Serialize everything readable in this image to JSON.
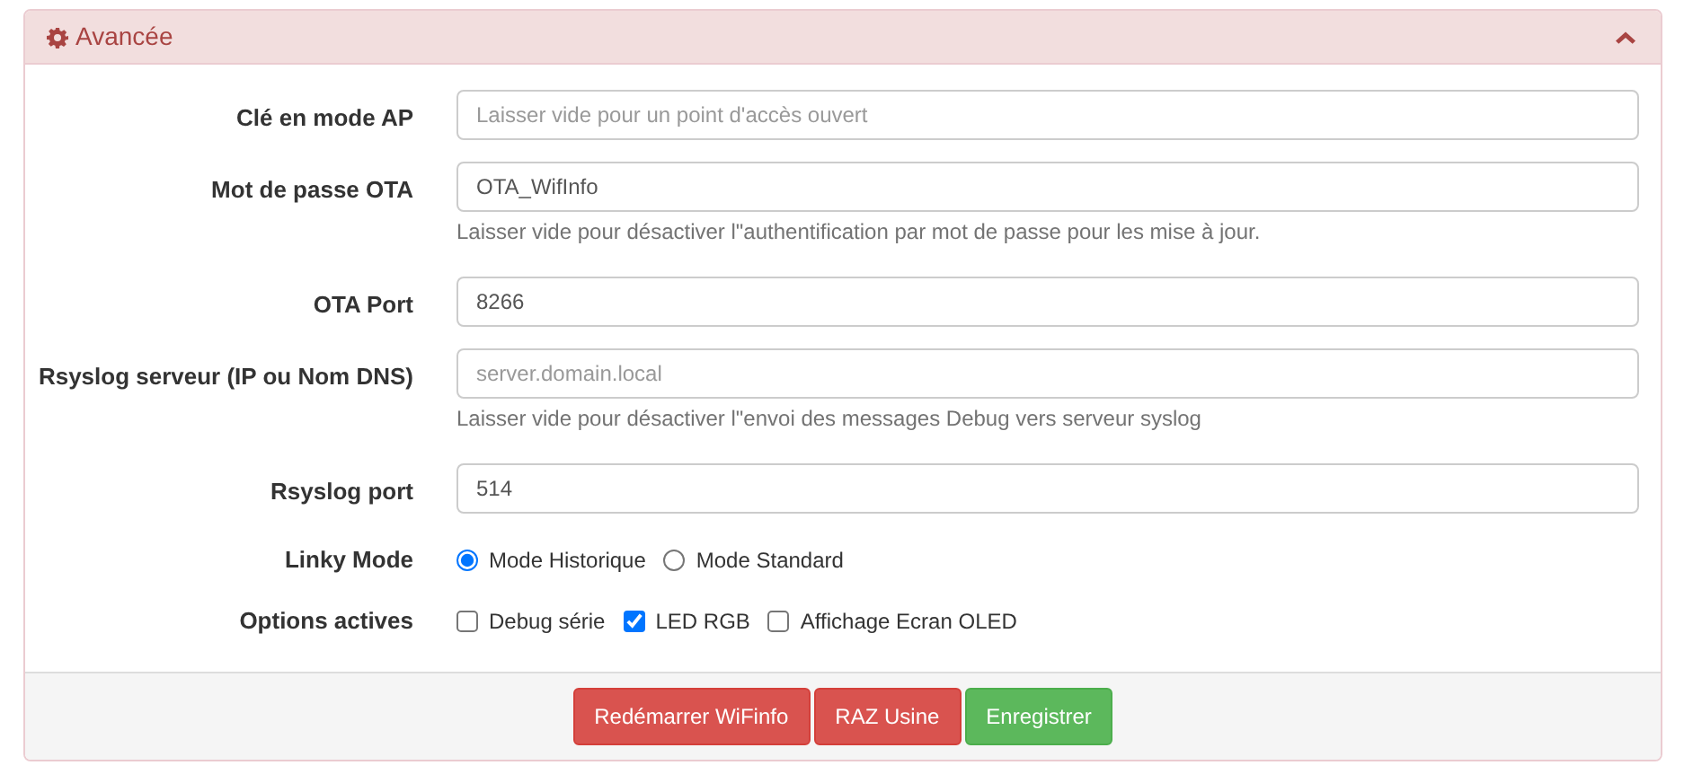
{
  "panel": {
    "title": "Avancée",
    "expanded": true
  },
  "fields": [
    {
      "kind": "text",
      "label": "Clé en mode AP",
      "placeholder": "Laisser vide pour un point d'accès ouvert"
    },
    {
      "kind": "text",
      "label": "Mot de passe OTA",
      "value": "OTA_WifInfo",
      "help": "Laisser vide pour désactiver l\"authentification par mot de passe pour les mise à jour."
    },
    {
      "kind": "text",
      "label": "OTA Port",
      "value": "8266"
    },
    {
      "kind": "text",
      "label": "Rsyslog serveur (IP ou Nom DNS)",
      "placeholder": "server.domain.local",
      "help": "Laisser vide pour désactiver l\"envoi des messages Debug vers serveur syslog"
    },
    {
      "kind": "text",
      "label": "Rsyslog port",
      "value": "514"
    },
    {
      "kind": "radio",
      "label": "Linky Mode",
      "options": [
        {
          "label": "Mode Historique",
          "selected": true
        },
        {
          "label": "Mode Standard",
          "selected": false
        }
      ]
    },
    {
      "kind": "checkbox",
      "label": "Options actives",
      "options": [
        {
          "label": "Debug série",
          "checked": false
        },
        {
          "label": "LED RGB",
          "checked": true
        },
        {
          "label": "Affichage Ecran OLED",
          "checked": false
        }
      ]
    }
  ],
  "buttons": [
    {
      "label": "Redémarrer WiFinfo",
      "kind": "danger"
    },
    {
      "label": "RAZ Usine",
      "kind": "danger"
    },
    {
      "label": "Enregistrer",
      "kind": "success"
    }
  ]
}
